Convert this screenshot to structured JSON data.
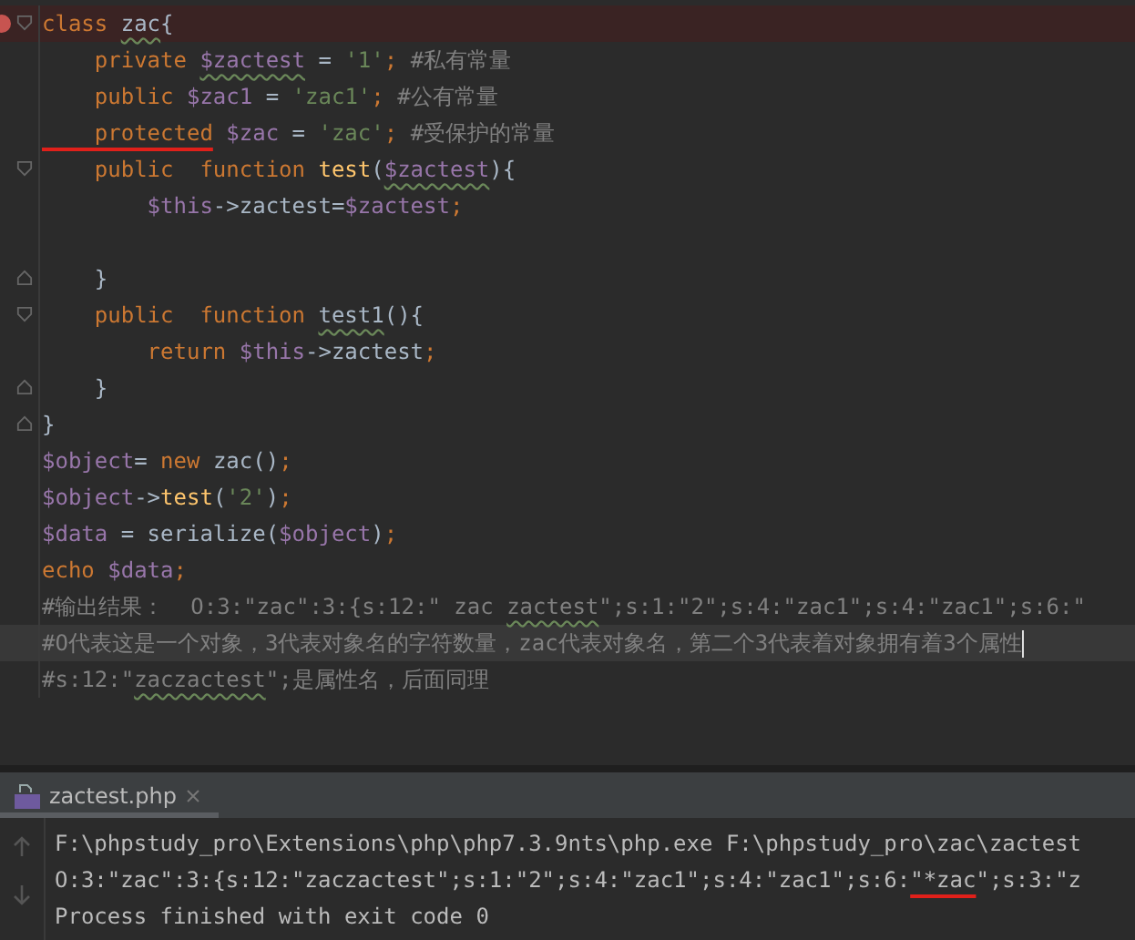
{
  "editor": {
    "lines": [
      {
        "breakpoint": true,
        "current": false,
        "fold_start": true,
        "tokens": [
          {
            "kind": "kw",
            "text": "class "
          },
          {
            "kind": "plain",
            "text": "zac",
            "squiggle": true
          },
          {
            "kind": "plain",
            "text": "{"
          }
        ]
      },
      {
        "breakpoint": false,
        "current": false,
        "tokens": [
          {
            "kind": "kw",
            "text": "    private "
          },
          {
            "kind": "var",
            "text": "$zactest",
            "squiggle": true
          },
          {
            "kind": "plain",
            "text": " = "
          },
          {
            "kind": "str",
            "text": "'1'"
          },
          {
            "kind": "kw",
            "text": "; "
          },
          {
            "kind": "comment",
            "text": "#私有常量"
          }
        ]
      },
      {
        "breakpoint": false,
        "current": false,
        "tokens": [
          {
            "kind": "kw",
            "text": "    public "
          },
          {
            "kind": "var",
            "text": "$zac1"
          },
          {
            "kind": "plain",
            "text": " = "
          },
          {
            "kind": "str",
            "text": "'zac1'"
          },
          {
            "kind": "kw",
            "text": "; "
          },
          {
            "kind": "comment",
            "text": "#公有常量"
          }
        ]
      },
      {
        "breakpoint": false,
        "current": false,
        "tokens": [
          {
            "kind": "kw",
            "text": "    protected",
            "annotated": true
          },
          {
            "kind": "var",
            "text": " $zac"
          },
          {
            "kind": "plain",
            "text": " = "
          },
          {
            "kind": "str",
            "text": "'zac'"
          },
          {
            "kind": "kw",
            "text": "; "
          },
          {
            "kind": "comment",
            "text": "#受保护的常量"
          }
        ]
      },
      {
        "breakpoint": false,
        "current": false,
        "fold_start": true,
        "tokens": [
          {
            "kind": "kw",
            "text": "    public  function "
          },
          {
            "kind": "fn",
            "text": "test"
          },
          {
            "kind": "plain",
            "text": "("
          },
          {
            "kind": "var",
            "text": "$zactest",
            "squiggle": true
          },
          {
            "kind": "plain",
            "text": "){"
          }
        ]
      },
      {
        "breakpoint": false,
        "current": false,
        "tokens": [
          {
            "kind": "var",
            "text": "        $this"
          },
          {
            "kind": "plain",
            "text": "->zactest="
          },
          {
            "kind": "var",
            "text": "$zactest"
          },
          {
            "kind": "kw",
            "text": ";"
          }
        ]
      },
      {
        "breakpoint": false,
        "current": false
      },
      {
        "breakpoint": false,
        "current": false,
        "fold_end": true,
        "tokens": [
          {
            "kind": "plain",
            "text": "    }"
          }
        ]
      },
      {
        "breakpoint": false,
        "current": false,
        "fold_start": true,
        "tokens": [
          {
            "kind": "kw",
            "text": "    public  function "
          },
          {
            "kind": "plain",
            "text": "test1",
            "squiggle": true
          },
          {
            "kind": "plain",
            "text": "(){"
          }
        ]
      },
      {
        "breakpoint": false,
        "current": false,
        "tokens": [
          {
            "kind": "kw",
            "text": "        return "
          },
          {
            "kind": "var",
            "text": "$this"
          },
          {
            "kind": "plain",
            "text": "->zactest"
          },
          {
            "kind": "kw",
            "text": ";"
          }
        ]
      },
      {
        "breakpoint": false,
        "current": false,
        "fold_end": true,
        "tokens": [
          {
            "kind": "plain",
            "text": "    }"
          }
        ]
      },
      {
        "breakpoint": false,
        "current": false,
        "fold_end": true,
        "tokens": [
          {
            "kind": "plain",
            "text": "}"
          }
        ]
      },
      {
        "breakpoint": false,
        "current": false,
        "tokens": [
          {
            "kind": "var",
            "text": "$object"
          },
          {
            "kind": "plain",
            "text": "= "
          },
          {
            "kind": "kw",
            "text": "new "
          },
          {
            "kind": "plain",
            "text": "zac()"
          },
          {
            "kind": "kw",
            "text": ";"
          }
        ]
      },
      {
        "breakpoint": false,
        "current": false,
        "tokens": [
          {
            "kind": "var",
            "text": "$object"
          },
          {
            "kind": "plain",
            "text": "->"
          },
          {
            "kind": "fn",
            "text": "test"
          },
          {
            "kind": "plain",
            "text": "("
          },
          {
            "kind": "str",
            "text": "'2'"
          },
          {
            "kind": "plain",
            "text": ")"
          },
          {
            "kind": "kw",
            "text": ";"
          }
        ]
      },
      {
        "breakpoint": false,
        "current": false,
        "tokens": [
          {
            "kind": "var",
            "text": "$data"
          },
          {
            "kind": "plain",
            "text": " = serialize("
          },
          {
            "kind": "var",
            "text": "$object"
          },
          {
            "kind": "plain",
            "text": ")"
          },
          {
            "kind": "kw",
            "text": ";"
          }
        ]
      },
      {
        "breakpoint": false,
        "current": false,
        "tokens": [
          {
            "kind": "kw",
            "text": "echo "
          },
          {
            "kind": "var",
            "text": "$data"
          },
          {
            "kind": "kw",
            "text": ";"
          }
        ]
      },
      {
        "breakpoint": false,
        "current": false,
        "tokens": [
          {
            "kind": "comment",
            "text": "#输出结果：  O:3:\"zac\":3:{s:12:\" zac "
          },
          {
            "kind": "comment",
            "text": "zactest",
            "squiggle": true
          },
          {
            "kind": "comment",
            "text": "\";s:1:\"2\";s:4:\"zac1\";s:4:\"zac1\";s:6:\""
          }
        ]
      },
      {
        "breakpoint": false,
        "current": true,
        "tokens": [
          {
            "kind": "comment",
            "text": "#O代表这是一个对象，3代表对象名的字符数量，zac代表对象名，第二个3代表着对象拥有着3个属性"
          }
        ]
      },
      {
        "breakpoint": false,
        "current": false,
        "tokens": [
          {
            "kind": "comment",
            "text": "#s:12:\""
          },
          {
            "kind": "comment",
            "text": "zaczactest",
            "squiggle": true
          },
          {
            "kind": "comment",
            "text": "\";是属性名，后面同理"
          }
        ]
      }
    ]
  },
  "run_panel": {
    "tab": {
      "label": "zactest.php",
      "selected": true
    },
    "output": [
      [
        {
          "text": "F:\\phpstudy_pro\\Extensions\\php\\php7.3.9nts\\php.exe F:\\phpstudy_pro\\zac\\zactest"
        }
      ],
      [
        {
          "text": "O:3:\"zac\":3:{s:12:\"zaczactest\";s:1:\"2\";s:4:\"zac1\";s:4:\"zac1\";s:6:"
        },
        {
          "text": "\"*zac",
          "annotated": true
        },
        {
          "text": "\";s:3:\"z"
        }
      ],
      [
        {
          "text": "Process finished with exit code 0"
        }
      ]
    ]
  }
}
